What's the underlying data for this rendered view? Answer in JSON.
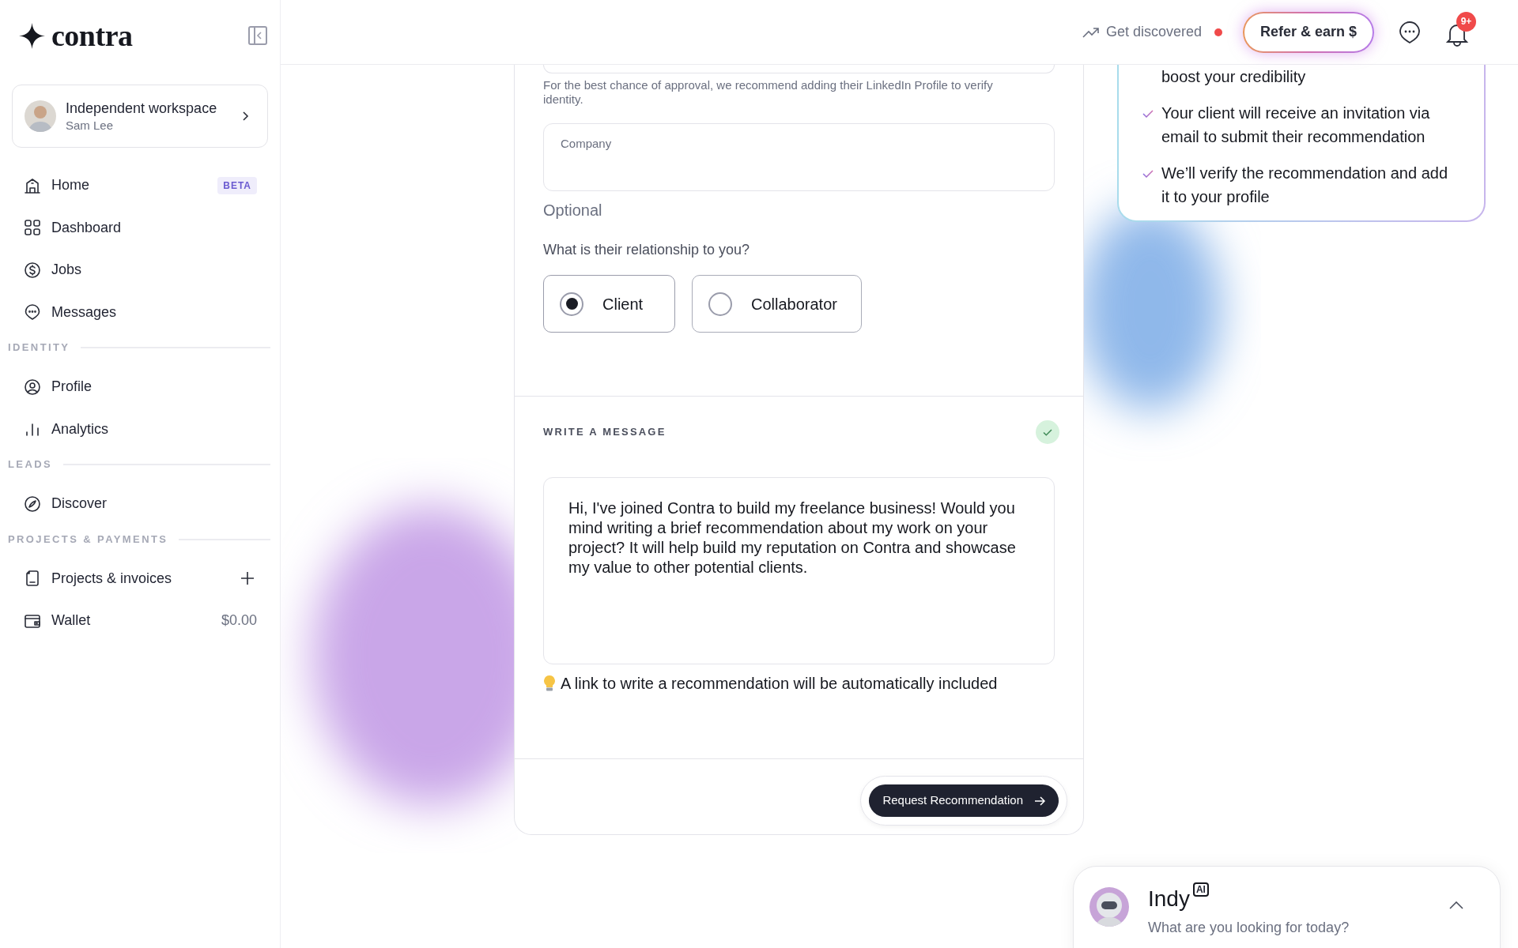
{
  "sidebar": {
    "logo": "contra",
    "workspace": {
      "title": "Independent workspace",
      "subtitle": "Sam Lee"
    },
    "groups": [
      {
        "items": [
          {
            "label": "Home",
            "badge": "BETA",
            "selected": false
          },
          {
            "label": "Dashboard",
            "selected": false
          },
          {
            "label": "Jobs",
            "selected": false
          },
          {
            "label": "Messages",
            "selected": false
          }
        ]
      },
      {
        "heading": "IDENTITY",
        "items": [
          {
            "label": "Profile",
            "selected": false
          },
          {
            "label": "Analytics",
            "selected": false
          }
        ]
      },
      {
        "heading": "LEADS",
        "items": [
          {
            "label": "Discover",
            "selected": false
          }
        ]
      },
      {
        "heading": "PROJECTS & PAYMENTS",
        "items": [
          {
            "label": "Projects & invoices",
            "selected": false
          },
          {
            "label": "Wallet",
            "amount": "$0.00",
            "selected": false
          }
        ]
      }
    ]
  },
  "header": {
    "get_discovered": {
      "label": "Get discovered",
      "alert": true
    },
    "refer_button": "Refer & earn $",
    "notifications_badge": "9+"
  },
  "form": {
    "linkedin_hint": "For the best chance of approval, we recommend adding their LinkedIn Profile to verify identity.",
    "company_field": {
      "label": "Company"
    },
    "optional_note": "Optional",
    "relationship_question": "What is their relationship to you?",
    "relationship_options": [
      {
        "label": "Client",
        "selected": true
      },
      {
        "label": "Collaborator",
        "selected": false
      }
    ],
    "message_section": {
      "heading": "WRITE A MESSAGE",
      "complete": true,
      "message": "Hi, I've joined Contra to build my freelance business! Would you mind writing a brief recommendation about my work on your project? It will help build my reputation on Contra and showcase my value to other potential clients.",
      "tip": "A link to write a recommendation will be automatically included"
    },
    "submit_button": "Request Recommendation"
  },
  "steps_card": {
    "items": [
      "boost your credibility",
      "Your client will receive an invitation via email to submit their recommendation",
      "We’ll verify the recommendation and add it to your profile"
    ]
  },
  "assistant": {
    "name": "Indy",
    "badge": "AI",
    "prompt": "What are you looking for today?"
  }
}
